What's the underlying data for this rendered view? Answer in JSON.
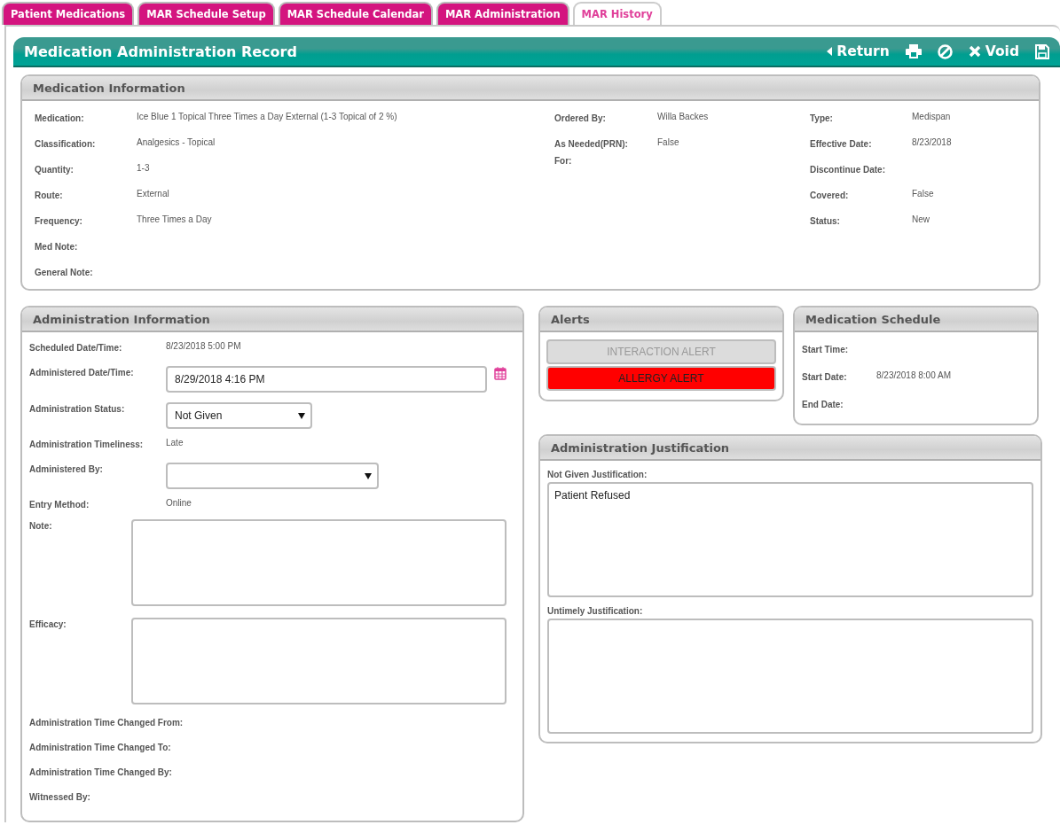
{
  "tabs": [
    {
      "label": "Patient Medications",
      "selected": false
    },
    {
      "label": "MAR Schedule Setup",
      "selected": false
    },
    {
      "label": "MAR Schedule Calendar",
      "selected": false
    },
    {
      "label": "MAR Administration",
      "selected": false
    },
    {
      "label": "MAR History",
      "selected": true
    }
  ],
  "header": {
    "title": "Medication Administration Record",
    "actions": [
      {
        "kind": "return",
        "label": "Return"
      },
      {
        "kind": "print"
      },
      {
        "kind": "cancel"
      },
      {
        "kind": "void",
        "label": "Void"
      },
      {
        "kind": "save"
      }
    ]
  },
  "medication_information": {
    "title": "Medication Information",
    "columns": [
      [
        {
          "label": "Medication:",
          "value": "Ice Blue 1 Topical Three Times a Day External (1-3 Topical of 2 %)"
        },
        {
          "label": "Classification:",
          "value": "Analgesics - Topical"
        },
        {
          "label": "Quantity:",
          "value": "1-3"
        },
        {
          "label": "Route:",
          "value": "External"
        },
        {
          "label": "Frequency:",
          "value": "Three Times a Day"
        },
        {
          "label": "Med Note:"
        },
        {
          "label": "General Note:"
        }
      ],
      [
        {
          "label": "Ordered By:",
          "value": "Willa Backes"
        },
        {
          "label": "As Needed(PRN):",
          "value": "False"
        },
        {
          "label": "For:"
        }
      ],
      [
        {
          "label": "Type:",
          "value": "Medispan"
        },
        {
          "label": "Effective Date:",
          "value": "8/23/2018"
        },
        {
          "label": "Discontinue Date:"
        },
        {
          "label": "Covered:",
          "value": "False"
        },
        {
          "label": "Status:",
          "value": "New"
        }
      ]
    ]
  },
  "administration_information": {
    "title": "Administration Information",
    "rows": [
      {
        "kind": "text",
        "label": "Scheduled Date/Time:",
        "value": "8/23/2018 5:00 PM"
      },
      {
        "kind": "date",
        "label": "Administered Date/Time:",
        "value": "8/29/2018 4:16 PM"
      },
      {
        "kind": "select",
        "label": "Administration Status:",
        "value": "Not Given"
      },
      {
        "kind": "text",
        "label": "Administration Timeliness:",
        "value": "Late"
      },
      {
        "kind": "select",
        "label": "Administered By:"
      },
      {
        "kind": "text",
        "label": "Entry Method:",
        "value": "Online"
      },
      {
        "kind": "textarea",
        "label": "Note:"
      },
      {
        "kind": "textarea",
        "label": "Efficacy:"
      },
      {
        "kind": "text",
        "label": "Administration Time Changed From:"
      },
      {
        "kind": "text",
        "label": "Administration Time Changed To:"
      },
      {
        "kind": "text",
        "label": "Administration Time Changed By:"
      },
      {
        "kind": "text",
        "label": "Witnessed By:"
      }
    ]
  },
  "alerts": {
    "title": "Alerts",
    "items": [
      {
        "label": "INTERACTION ALERT",
        "active": false
      },
      {
        "label": "ALLERGY ALERT",
        "active": true
      }
    ]
  },
  "medication_schedule": {
    "title": "Medication Schedule",
    "rows": [
      {
        "label": "Start Time:"
      },
      {
        "label": "Start Date:",
        "value": "8/23/2018 8:00 AM"
      },
      {
        "label": "End Date:"
      }
    ]
  },
  "administration_justification": {
    "title": "Administration Justification",
    "fields": [
      {
        "label": "Not Given Justification:",
        "value": "Patient Refused"
      },
      {
        "label": "Untimely Justification:"
      }
    ]
  }
}
